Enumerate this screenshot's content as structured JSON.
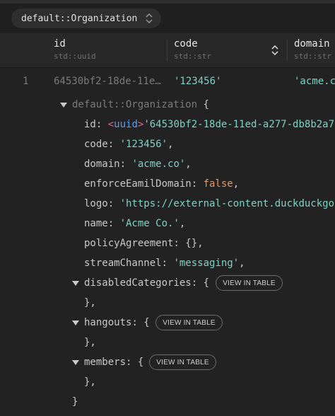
{
  "toolbar": {
    "object_type": "default::Organization"
  },
  "columns": [
    {
      "name": "id",
      "type": "std::uuid"
    },
    {
      "name": "code",
      "type": "std::str"
    },
    {
      "name": "domain",
      "type": "std::str"
    }
  ],
  "row": {
    "index": "1",
    "id": "64530bf2-18de-11e…",
    "code": "'123456'",
    "domain": "'acme.c"
  },
  "detail": {
    "type_name": "default::Organization",
    "open_brace": "{",
    "fields": {
      "id": {
        "key": "id",
        "tag": "uuid",
        "value": "'64530bf2-18de-11ed-a277-db8b2a72"
      },
      "code": {
        "key": "code",
        "value": "'123456'"
      },
      "domain": {
        "key": "domain",
        "value": "'acme.co'"
      },
      "enforce": {
        "key": "enforceEamilDomain",
        "value": "false"
      },
      "logo": {
        "key": "logo",
        "value": "'https://external-content.duckduckgo"
      },
      "name": {
        "key": "name",
        "value": "'Acme Co.'"
      },
      "policy": {
        "key": "policyAgreement",
        "value": "{}"
      },
      "stream": {
        "key": "streamChannel",
        "value": "'messaging'"
      }
    },
    "links": {
      "disabled": {
        "key": "disabledCategories",
        "button": "VIEW IN TABLE"
      },
      "hangouts": {
        "key": "hangouts",
        "button": "VIEW IN TABLE"
      },
      "members": {
        "key": "members",
        "button": "VIEW IN TABLE"
      }
    },
    "close_brace": "}"
  }
}
